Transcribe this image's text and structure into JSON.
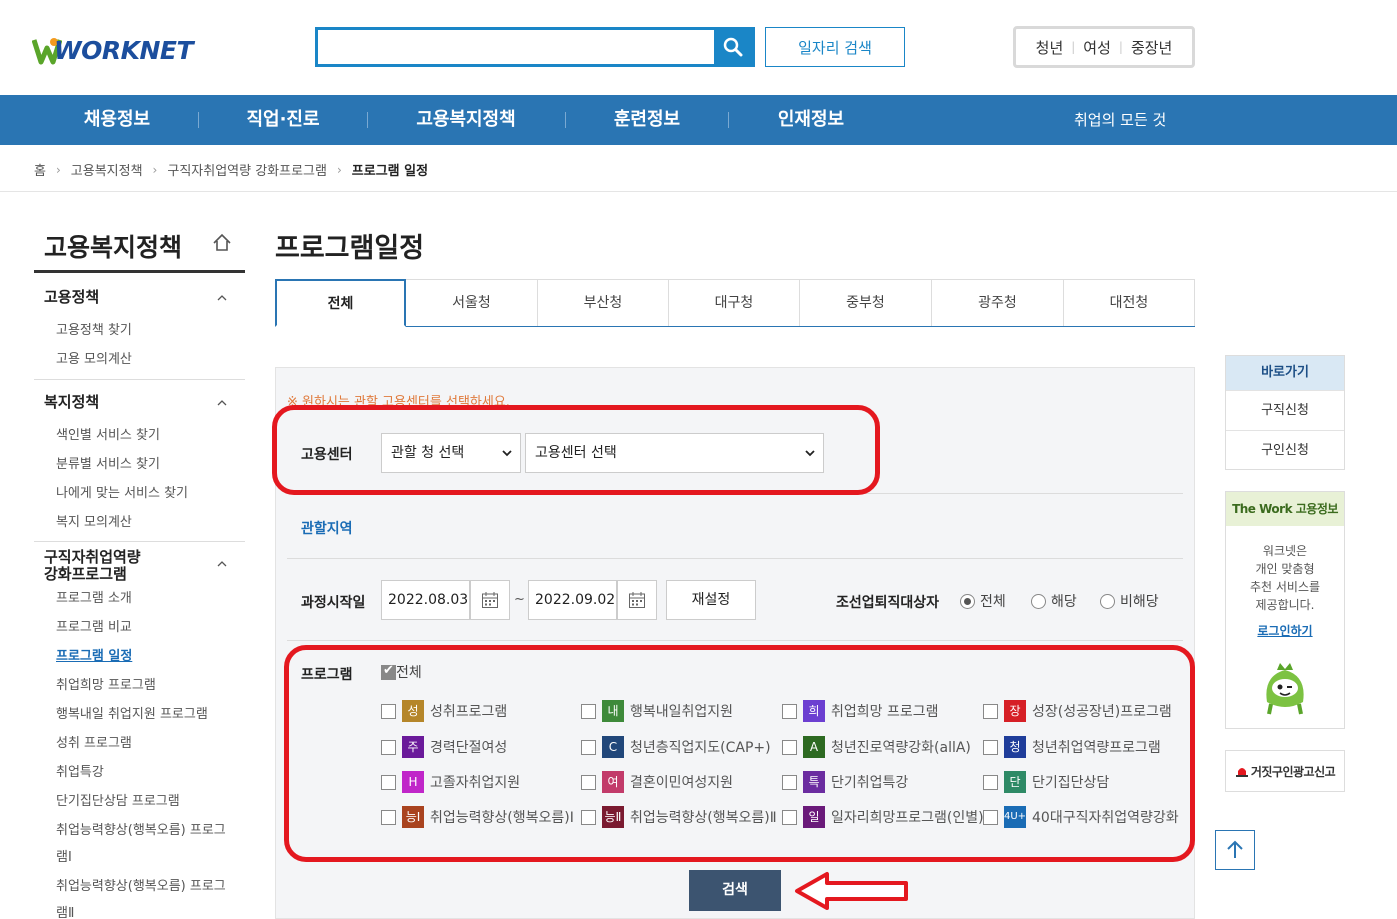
{
  "header": {
    "logo_text": "WORKNET",
    "search_placeholder": "",
    "job_search_label": "일자리 검색",
    "targets": [
      "청년",
      "여성",
      "중장년"
    ]
  },
  "gnb": {
    "items": [
      "채용정보",
      "직업·진로",
      "고용복지정책",
      "훈련정보",
      "인재정보"
    ],
    "all_label": "취업의 모든 것"
  },
  "breadcrumb": [
    "홈",
    "고용복지정책",
    "구직자취업역량 강화프로그램",
    "프로그램 일정"
  ],
  "sidebar": {
    "title": "고용복지정책",
    "groups": [
      {
        "title": "고용정책",
        "items": [
          "고용정책 찾기",
          "고용 모의계산"
        ]
      },
      {
        "title": "복지정책",
        "items": [
          "색인별 서비스 찾기",
          "분류별 서비스 찾기",
          "나에게 맞는 서비스 찾기",
          "복지 모의계산"
        ]
      },
      {
        "title_line1": "구직자취업역량",
        "title_line2": "강화프로그램",
        "items": [
          "프로그램 소개",
          "프로그램 비교",
          "프로그램 일정",
          "취업희망 프로그램",
          "행복내일 취업지원 프로그램",
          "성취 프로그램",
          "취업특강",
          "단기집단상담 프로그램",
          "취업능력향상(행복오름) 프로그",
          "램Ⅰ",
          "취업능력향상(행복오름) 프로그",
          "램Ⅱ"
        ]
      }
    ]
  },
  "main": {
    "title": "프로그램일정",
    "tabs": [
      "전체",
      "서울청",
      "부산청",
      "대구청",
      "중부청",
      "광주청",
      "대전청"
    ],
    "notice": "※ 원하시는 관할 고용센터를 선택하세요.",
    "center_label": "고용센터",
    "select_office": "관할 청 선택",
    "select_center": "고용센터 선택",
    "region_label": "관할지역",
    "start_label": "과정시작일",
    "date_from": "2022.08.03",
    "date_to": "2022.09.02",
    "tilde": "~",
    "reset_label": "재설정",
    "shipbuilding_label": "조선업퇴직대상자",
    "radios": [
      "전체",
      "해당",
      "비해당"
    ],
    "program_label": "프로그램",
    "all_label": "전체",
    "programs": [
      {
        "badge": "성",
        "name": "성취프로그램",
        "color": "#b5862a"
      },
      {
        "badge": "내",
        "name": "행복내일취업지원",
        "color": "#3e8a3a"
      },
      {
        "badge": "희",
        "name": "취업희망 프로그램",
        "color": "#6c3fd1"
      },
      {
        "badge": "장",
        "name": "성장(성공장년)프로그램",
        "color": "#d61f26"
      },
      {
        "badge": "주",
        "name": "경력단절여성",
        "color": "#6a1a9a"
      },
      {
        "badge": "C",
        "name": "청년층직업지도(CAP+)",
        "color": "#21477a"
      },
      {
        "badge": "A",
        "name": "청년진로역량강화(allA)",
        "color": "#2d6a22"
      },
      {
        "badge": "청",
        "name": "청년취업역량프로그램",
        "color": "#1f3d9a"
      },
      {
        "badge": "H",
        "name": "고졸자취업지원",
        "color": "#c026c9"
      },
      {
        "badge": "여",
        "name": "결혼이민여성지원",
        "color": "#c23b6a"
      },
      {
        "badge": "특",
        "name": "단기취업특강",
        "color": "#6b2ca0"
      },
      {
        "badge": "단",
        "name": "단기집단상담",
        "color": "#2e8a66"
      },
      {
        "badge": "능Ⅰ",
        "name": "취업능력향상(행복오름)Ⅰ",
        "color": "#a9431f"
      },
      {
        "badge": "능Ⅱ",
        "name": "취업능력향상(행복오름)Ⅱ",
        "color": "#7a1a30"
      },
      {
        "badge": "일",
        "name": "일자리희망프로그램(인별)",
        "color": "#6a1a7a"
      },
      {
        "badge": "4U+",
        "name": "40대구직자취업역량강화",
        "color": "#1a6cb5"
      }
    ],
    "search_label": "검색"
  },
  "quick": {
    "title": "바로가기",
    "items": [
      "구직신청",
      "구인신청"
    ]
  },
  "thework": {
    "title": "The Work 고용정보",
    "lines": [
      "워크넷은",
      "개인 맞춤형",
      "추천 서비스를",
      "제공합니다."
    ],
    "login": "로그인하기"
  },
  "report_label": "거짓구인광고신고"
}
